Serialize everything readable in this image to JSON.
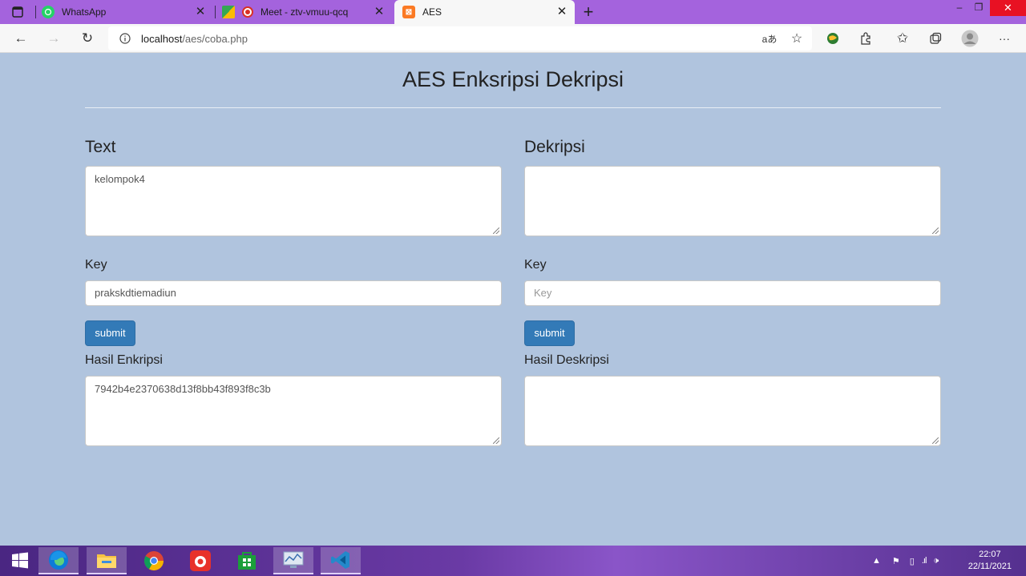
{
  "browser": {
    "tabs": [
      {
        "label": "WhatsApp",
        "icon": "whatsapp-icon"
      },
      {
        "label": "Meet - ztv-vmuu-qcq",
        "icon": "google-meet-icon"
      },
      {
        "label": "AES",
        "icon": "xampp-icon",
        "active": true
      }
    ],
    "new_tab_label": "+",
    "address": {
      "host": "localhost",
      "path": "/aes/coba.php"
    },
    "window_controls": {
      "minimize": "–",
      "restore": "❐",
      "close": "✕"
    }
  },
  "page": {
    "title": "AES Enksripsi Dekripsi",
    "left": {
      "heading": "Text",
      "text_value": "kelompok4",
      "key_label": "Key",
      "key_value": "prakskdtiemadiun",
      "submit_label": "submit",
      "result_label": "Hasil Enkripsi",
      "result_value": "7942b4e2370638d13f8bb43f893f8c3b"
    },
    "right": {
      "heading": "Dekripsi",
      "text_value": "",
      "key_label": "Key",
      "key_placeholder": "Key",
      "submit_label": "submit",
      "result_label": "Hasil Deskripsi",
      "result_value": ""
    }
  },
  "taskbar": {
    "apps": [
      "windows-start-icon",
      "edge-icon",
      "file-explorer-icon",
      "chrome-icon",
      "app-red-icon",
      "store-icon",
      "app-monitor-icon",
      "vscode-icon"
    ],
    "clock": {
      "time": "22:07",
      "date": "22/11/2021"
    }
  },
  "colors": {
    "accent": "#a463dd",
    "page_bg": "#b0c4de",
    "button": "#337ab7"
  }
}
